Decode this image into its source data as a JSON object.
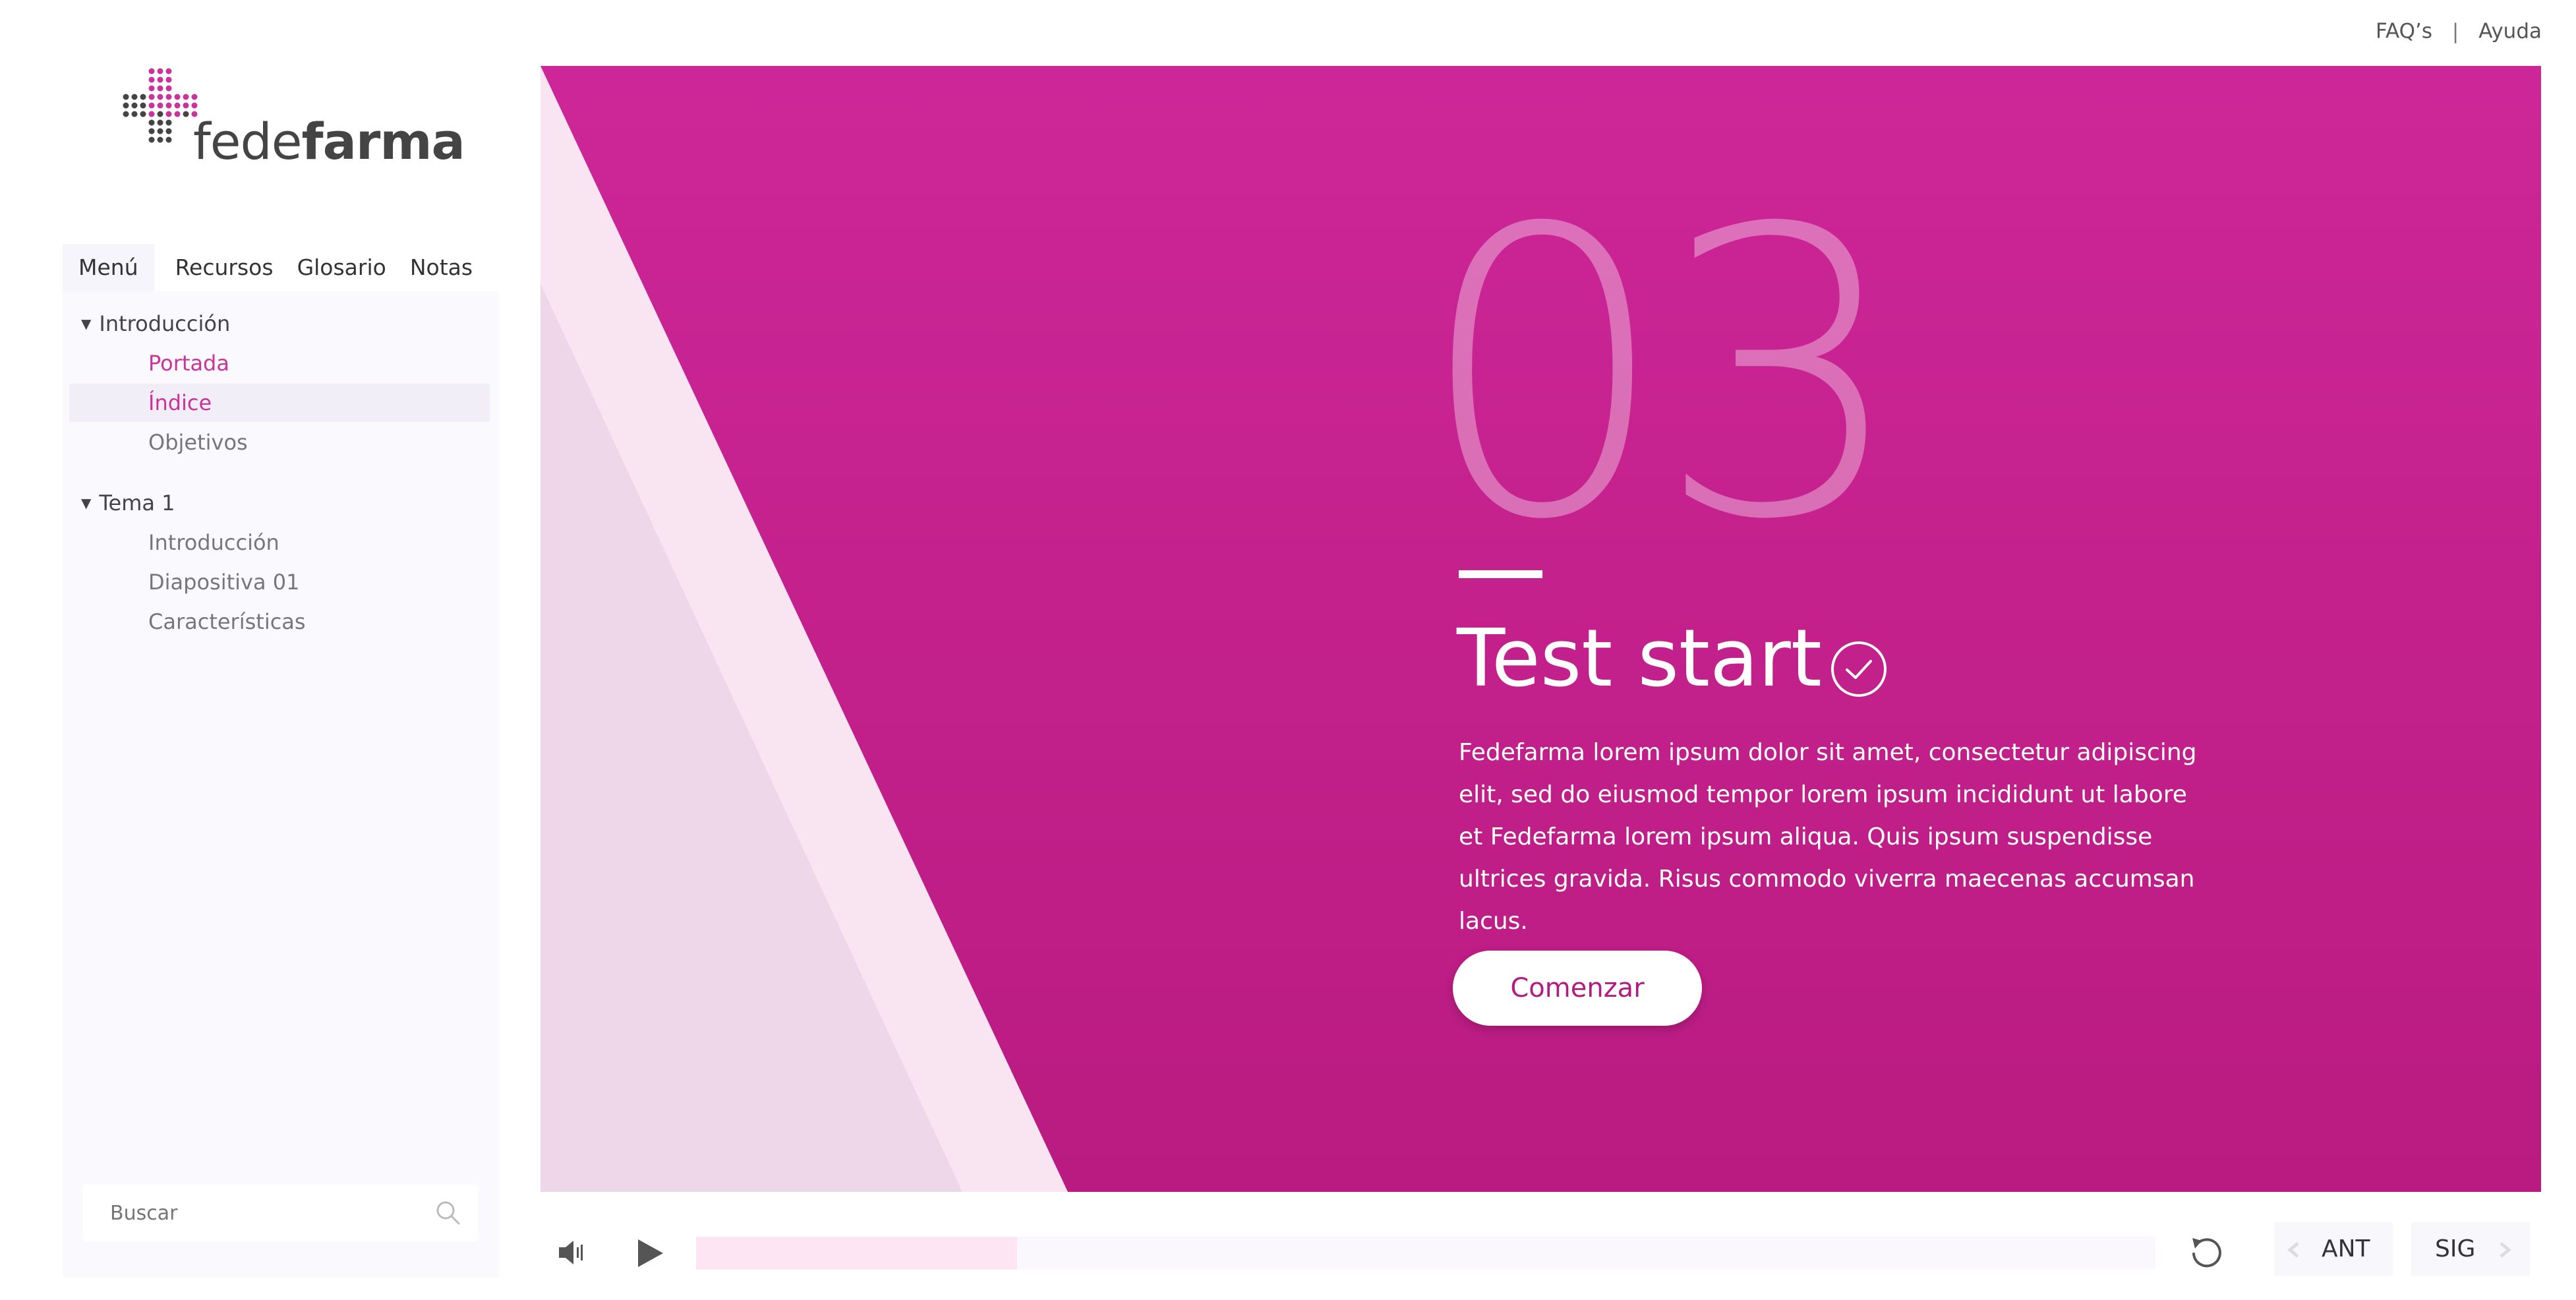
{
  "topbar": {
    "faq": "FAQ’s",
    "separator": "|",
    "help": "Ayuda"
  },
  "logo": {
    "light": "fede",
    "bold": "farma"
  },
  "tabs": [
    "Menú",
    "Recursos",
    "Glosario",
    "Notas"
  ],
  "menu": {
    "groups": [
      {
        "label": "Introducción",
        "items": [
          "Portada",
          "Índice",
          "Objetivos"
        ]
      },
      {
        "label": "Tema 1",
        "items": [
          "Introducción",
          "Diapositiva 01",
          "Características"
        ]
      }
    ],
    "active_item": "Índice",
    "visited_item": "Portada"
  },
  "search": {
    "placeholder": "Buscar"
  },
  "slide": {
    "number": "03",
    "title": "Test start",
    "body": "Fedefarma lorem ipsum dolor sit amet, consectetur adipiscing elit, sed do eiusmod tempor  lorem ipsum incididunt ut labore et Fedefarma lorem ipsum aliqua. Quis ipsum suspendisse ultrices gravida. Risus commodo viverra maecenas accumsan lacus.",
    "button": "Comenzar"
  },
  "player": {
    "progress_fraction": 0.22,
    "prev_label": "ANT",
    "next_label": "SIG"
  },
  "colors": {
    "brand_magenta": "#c5228f",
    "logo_pink": "#c9339e",
    "visited_link": "#c9339e"
  },
  "icons": [
    "volume-icon",
    "play-icon",
    "replay-icon",
    "chevron-left-icon",
    "chevron-right-icon",
    "search-icon",
    "check-circle-icon",
    "triangle-down-icon"
  ]
}
